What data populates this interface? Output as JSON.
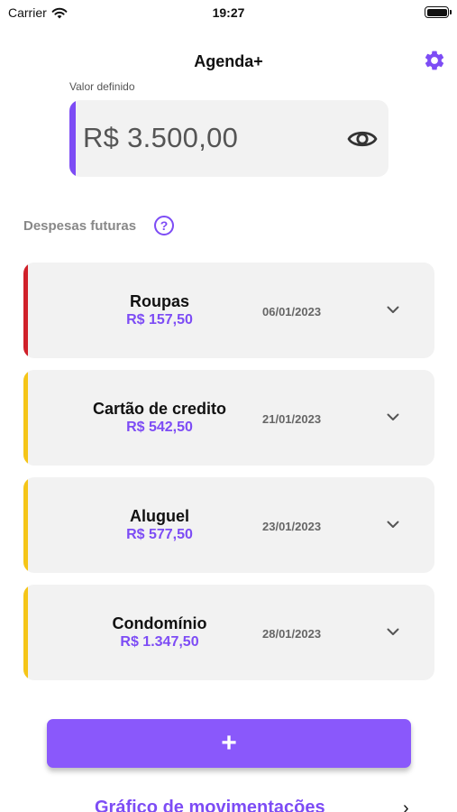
{
  "status_bar": {
    "carrier": "Carrier",
    "time": "19:27"
  },
  "header": {
    "title": "Agenda+",
    "settings_icon": "gear-icon"
  },
  "balance": {
    "label": "Valor definido",
    "value": "R$ 3.500,00",
    "toggle_icon": "eye-icon"
  },
  "section": {
    "title": "Despesas futuras",
    "help": "?"
  },
  "expenses": [
    {
      "name": "Roupas",
      "amount": "R$ 157,50",
      "date": "06/01/2023",
      "status_color": "#d0202a"
    },
    {
      "name": "Cartão de credito",
      "amount": "R$ 542,50",
      "date": "21/01/2023",
      "status_color": "#f5c518"
    },
    {
      "name": "Aluguel",
      "amount": "R$ 577,50",
      "date": "23/01/2023",
      "status_color": "#f5c518"
    },
    {
      "name": "Condomínio",
      "amount": "R$ 1.347,50",
      "date": "28/01/2023",
      "status_color": "#f5c518"
    }
  ],
  "add_button": {
    "label": "+"
  },
  "footer_link": {
    "label": "Gráfico de movimentações",
    "arrow": "›"
  },
  "colors": {
    "accent": "#7d4cf5",
    "button": "#8a58fb",
    "card_bg": "#f2f2f2"
  }
}
